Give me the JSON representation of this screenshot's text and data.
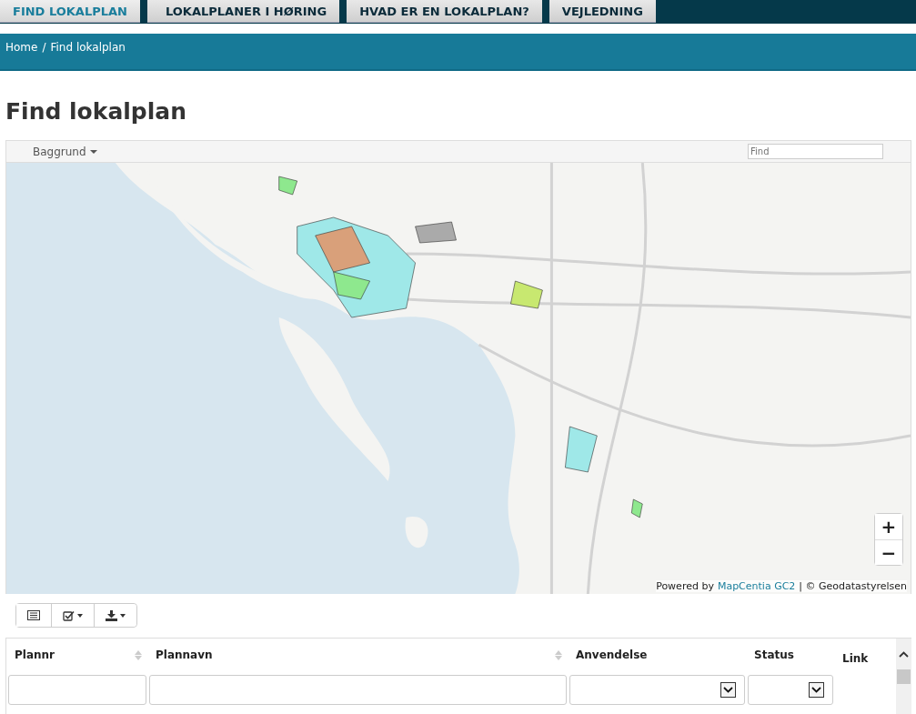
{
  "nav": {
    "tabs": [
      {
        "label": "FIND LOKALPLAN",
        "selected": true
      },
      {
        "label": "LOKALPLANER I HØRING",
        "selected": false
      },
      {
        "label": "HVAD ER EN LOKALPLAN?",
        "selected": false
      },
      {
        "label": "VEJLEDNING",
        "selected": false
      }
    ]
  },
  "breadcrumb": {
    "items": [
      "Home",
      "Find lokalplan"
    ],
    "separator": "/"
  },
  "page_title": "Find lokalplan",
  "map": {
    "background_menu": "Baggrund",
    "search": {
      "placeholder": "Find"
    },
    "zoom_in": "+",
    "zoom_out": "−",
    "attribution": {
      "prefix": "Powered by",
      "link": "MapCentia GC2",
      "suffix": "| © Geodatastyrelsen"
    }
  },
  "table": {
    "columns": [
      {
        "label": "Plannr",
        "sortable": true,
        "kind": "text"
      },
      {
        "label": "Plannavn",
        "sortable": true,
        "kind": "text"
      },
      {
        "label": "Anvendelse",
        "sortable": false,
        "kind": "select"
      },
      {
        "label": "Status",
        "sortable": false,
        "kind": "select"
      },
      {
        "label": "Link",
        "sortable": false,
        "kind": "none"
      }
    ]
  }
}
